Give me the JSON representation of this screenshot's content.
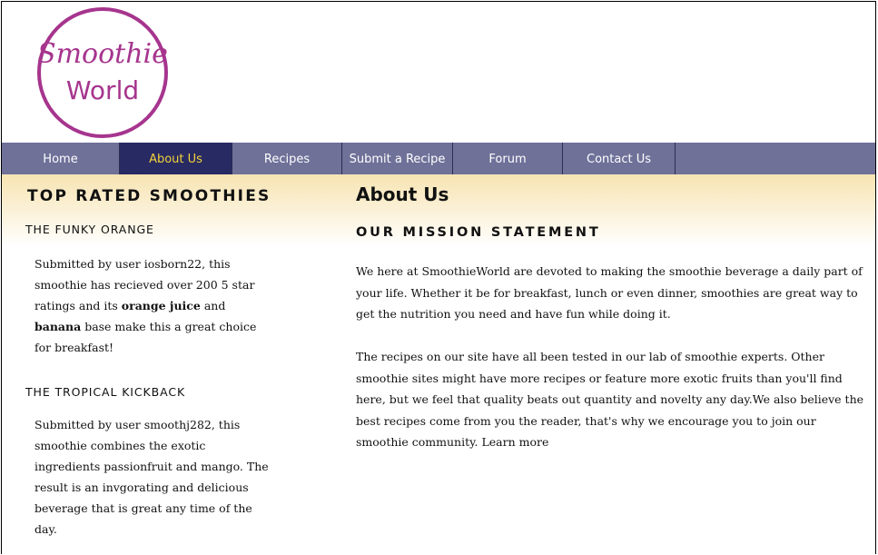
{
  "logo": {
    "line1": "Smoothie",
    "line2": "World"
  },
  "nav": {
    "items": [
      {
        "label": "Home"
      },
      {
        "label": "About Us"
      },
      {
        "label": "Recipes"
      },
      {
        "label": "Submit a Recipe"
      },
      {
        "label": "Forum"
      },
      {
        "label": "Contact Us"
      }
    ]
  },
  "sidebar": {
    "title": "TOP RATED SMOOTHIES",
    "items": [
      {
        "name": "THE FUNKY ORANGE",
        "text_pre": "Submitted by user iosborn22, this smoothie has recieved over 200 5 star ratings and its ",
        "bold1": "orange juice",
        "text_mid": " and ",
        "bold2": "banana",
        "text_post": " base make this a great choice for breakfast!"
      },
      {
        "name": "THE TROPICAL KICKBACK",
        "text": "Submitted by user smoothj282, this smoothie combines the exotic ingredients passionfruit and mango. The result is an invgorating and delicious beverage that is great any time of the day."
      }
    ]
  },
  "main": {
    "title": "About Us",
    "subtitle": "OUR MISSION STATEMENT",
    "para1": "We here at SmoothieWorld are devoted to making the smoothie beverage a daily part of your life. Whether it be for breakfast, lunch or even dinner, smoothies are great way to get the nutrition you need and have fun while doing it.",
    "para2": "The recipes on our site have all been tested in our lab of smoothie experts. Other smoothie sites might have more recipes or feature more exotic fruits than you'll find here, but we feel that quality beats out quantity and novelty any day.We also believe the best recipes come from you the reader, that's why we encourage you to join our smoothie community. ",
    "learn_more": "Learn more"
  },
  "colors": {
    "nav_bg": "#6f7199",
    "nav_active_bg": "#282a63",
    "nav_active_text": "#f2d23a",
    "logo_purple": "#a6358e",
    "content_gradient_top": "#f7e4b2"
  }
}
